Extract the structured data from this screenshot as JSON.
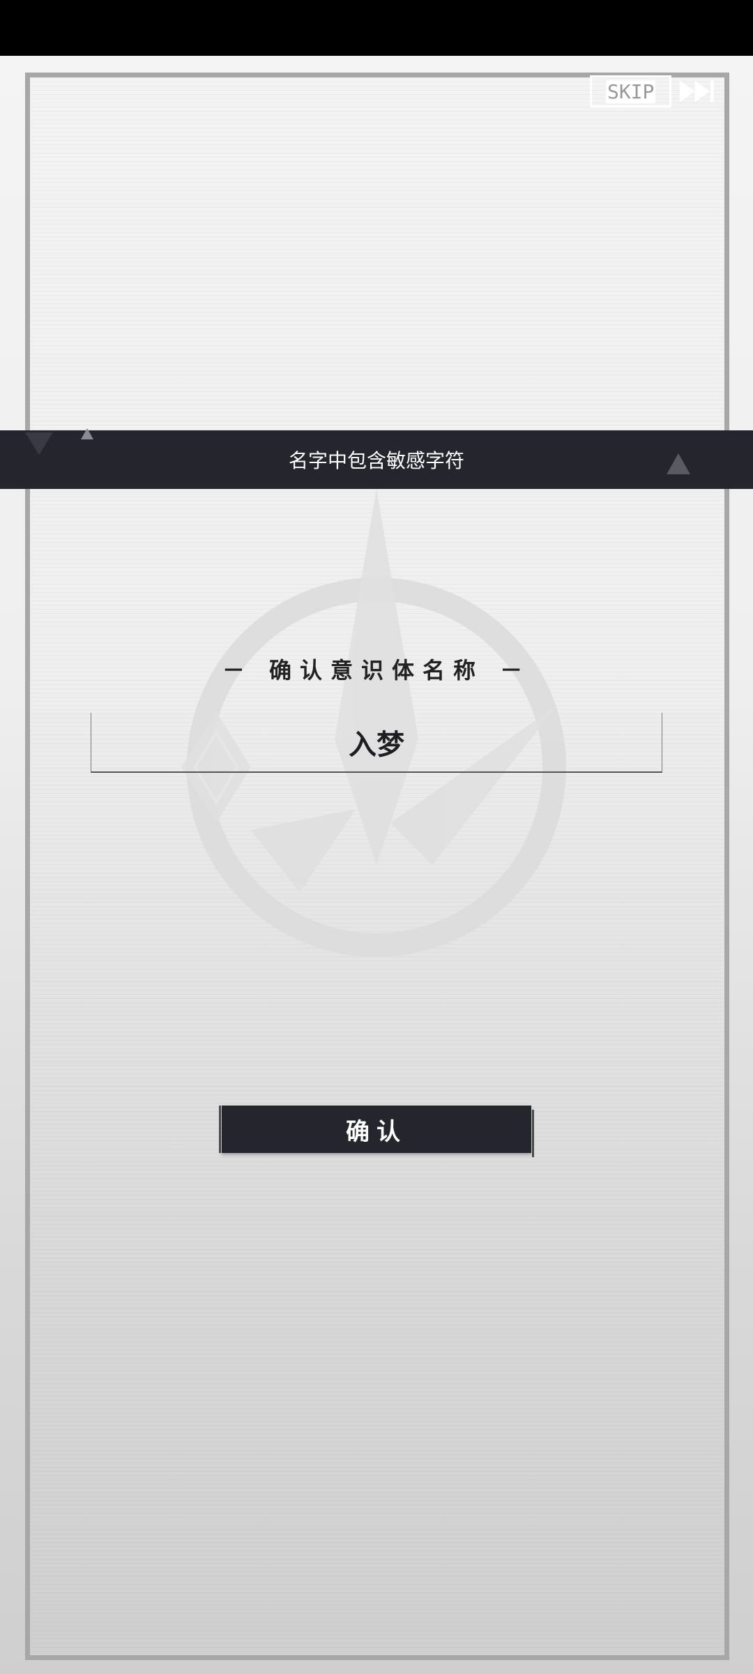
{
  "top_bar": {
    "skip_label": "SKIP",
    "skip_icon": "fast-forward-icon"
  },
  "toast": {
    "message": "名字中包含敏感字符"
  },
  "dialog": {
    "title": "－ 确认意识体名称 －",
    "name_value": "入梦",
    "confirm_label": "确认"
  },
  "colors": {
    "dark_panel": "#25262d",
    "frame_border": "#a7a7a7",
    "background": "#efefef"
  }
}
